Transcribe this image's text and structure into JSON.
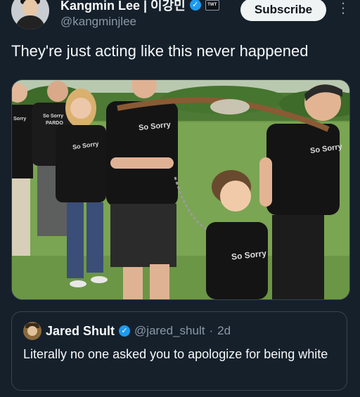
{
  "author": {
    "display_name": "Kangmin Lee | 이강민",
    "handle": "@kangminjlee",
    "affiliation_badge": "TWT",
    "verified_icon": "verified-badge-icon"
  },
  "actions": {
    "subscribe_label": "Subscribe",
    "more_icon": "⋮"
  },
  "tweet": {
    "text": "They're just acting like this never happened"
  },
  "media": {
    "shirt_text_1": "Sorry",
    "shirt_text_2": "So Sorry",
    "shirt_text_3": "PARDO",
    "shirt_text_4": "So Sorry",
    "shirt_text_5": "So Sorry",
    "shirt_text_6": "So Sorry",
    "shirt_text_7": "So Sorry"
  },
  "quote": {
    "display_name": "Jared Shult",
    "handle": "@jared_shult",
    "separator": "·",
    "timestamp": "2d",
    "text": "Literally no one asked you to apologize for being white"
  },
  "colors": {
    "background": "#15202b",
    "accent": "#1d9bf0",
    "muted": "#8b98a5"
  }
}
